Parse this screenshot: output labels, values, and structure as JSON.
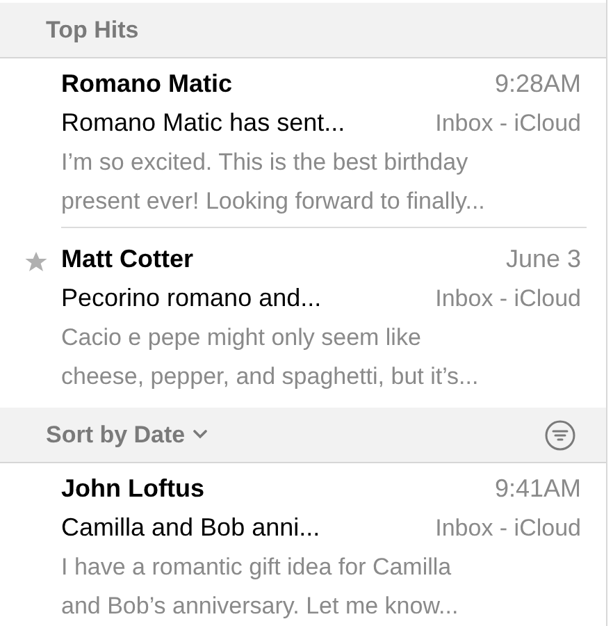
{
  "sections": [
    {
      "kind": "header",
      "title": "Top Hits",
      "messages": [
        {
          "sender": "Romano Matic",
          "time": "9:28AM",
          "subject": "Romano Matic has sent...",
          "mailbox": "Inbox - iCloud",
          "preview": [
            "I’m so excited. This is the best birthday",
            "present ever! Looking forward to finally..."
          ],
          "flagged": false
        },
        {
          "sender": "Matt Cotter",
          "time": "June 3",
          "subject": "Pecorino romano and...",
          "mailbox": "Inbox - iCloud",
          "preview": [
            "Cacio e pepe might only seem like",
            "cheese, pepper, and spaghetti, but it’s..."
          ],
          "flagged": true
        }
      ]
    },
    {
      "kind": "sort",
      "title": "Sort by Date",
      "messages": [
        {
          "sender": "John Loftus",
          "time": "9:41AM",
          "subject": "Camilla and Bob anni...",
          "mailbox": "Inbox - iCloud",
          "preview": [
            "I have a romantic gift idea for Camilla",
            "and Bob’s anniversary. Let me know..."
          ],
          "flagged": false
        }
      ]
    }
  ]
}
